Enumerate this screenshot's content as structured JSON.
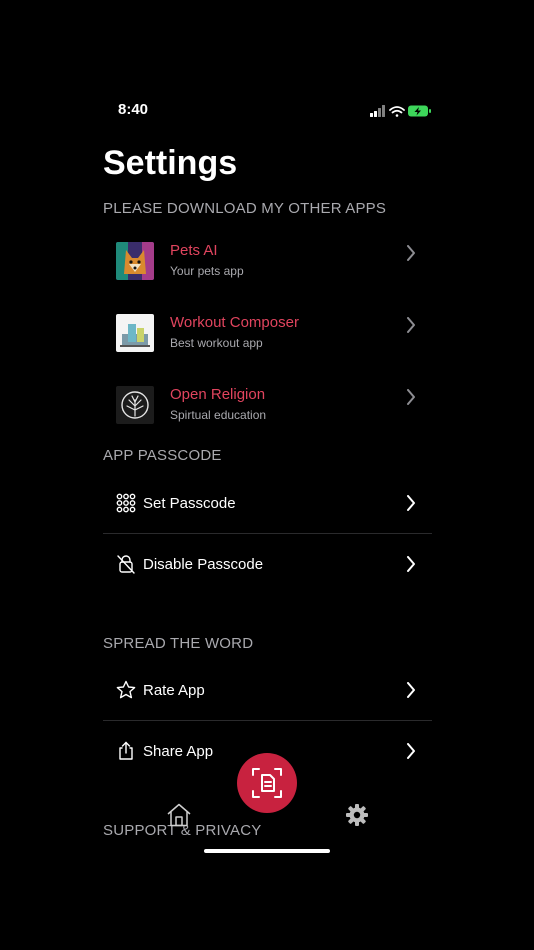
{
  "status_bar": {
    "time": "8:40"
  },
  "title": "Settings",
  "sections": {
    "other_apps": "PLEASE DOWNLOAD MY OTHER APPS",
    "passcode": "APP PASSCODE",
    "spread": "SPREAD THE WORD",
    "support": "SUPPORT & PRIVACY"
  },
  "other_apps": [
    {
      "name": "Pets AI",
      "subtitle": "Your pets app"
    },
    {
      "name": "Workout Composer",
      "subtitle": "Best workout app"
    },
    {
      "name": "Open Religion",
      "subtitle": "Spirtual education"
    }
  ],
  "passcode_options": [
    {
      "label": "Set Passcode",
      "icon": "keypad-icon"
    },
    {
      "label": "Disable Passcode",
      "icon": "lock-slash-icon"
    }
  ],
  "spread_options": [
    {
      "label": "Rate App",
      "icon": "star-icon"
    },
    {
      "label": "Share App",
      "icon": "share-icon"
    }
  ],
  "tab_bar": {
    "home": "home-icon",
    "scan": "document-scan-icon",
    "settings": "gear-icon"
  },
  "colors": {
    "accent": "#e0445e",
    "fab": "#c8223f",
    "section_text": "#a9a9ae",
    "background": "#000000"
  }
}
